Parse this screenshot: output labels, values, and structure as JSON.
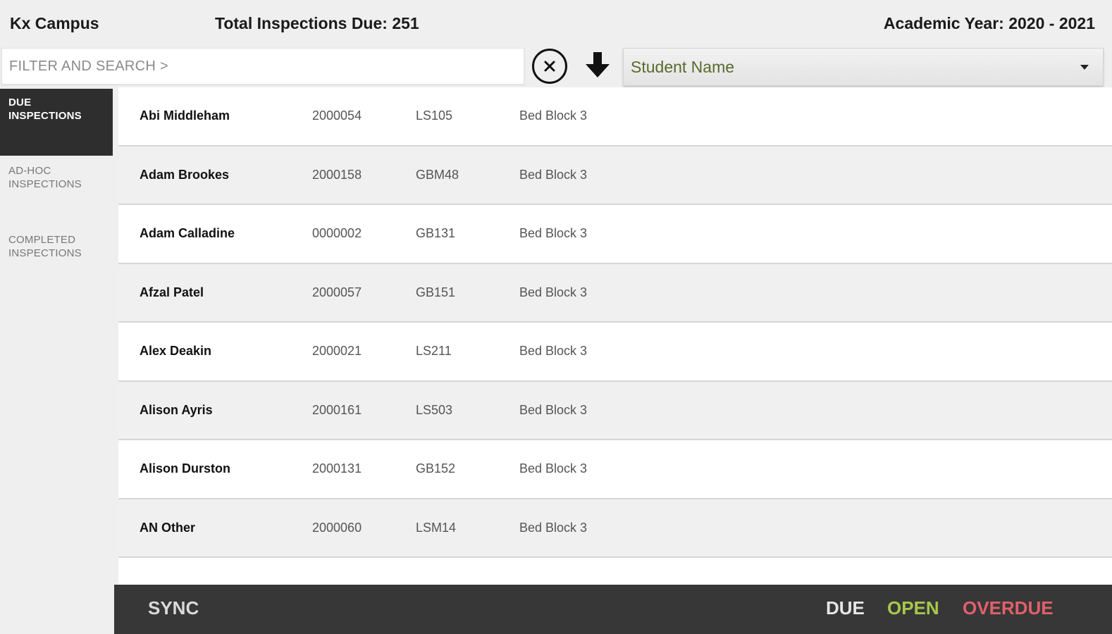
{
  "header": {
    "campus": "Kx Campus",
    "total_due": "Total Inspections Due: 251",
    "academic_year": "Academic Year: 2020 - 2021"
  },
  "toolbar": {
    "search_placeholder": "FILTER AND SEARCH >",
    "sort_selected": "Student Name",
    "clear_icon": "close-circle-icon",
    "download_icon": "arrow-down-icon"
  },
  "sidebar": {
    "items": [
      {
        "label": "DUE INSPECTIONS",
        "active": true
      },
      {
        "label": "AD-HOC INSPECTIONS",
        "active": false
      },
      {
        "label": "COMPLETED INSPECTIONS",
        "active": false
      }
    ]
  },
  "inspections": [
    {
      "name": "Abi Middleham",
      "id": "2000054",
      "room": "LS105",
      "block": "Bed Block 3"
    },
    {
      "name": "Adam Brookes",
      "id": "2000158",
      "room": "GBM48",
      "block": "Bed Block 3"
    },
    {
      "name": "Adam Calladine",
      "id": "0000002",
      "room": "GB131",
      "block": "Bed Block 3"
    },
    {
      "name": "Afzal Patel",
      "id": "2000057",
      "room": "GB151",
      "block": "Bed Block 3"
    },
    {
      "name": "Alex Deakin",
      "id": "2000021",
      "room": "LS211",
      "block": "Bed Block 3"
    },
    {
      "name": "Alison Ayris",
      "id": "2000161",
      "room": "LS503",
      "block": "Bed Block 3"
    },
    {
      "name": "Alison Durston",
      "id": "2000131",
      "room": "GB152",
      "block": "Bed Block 3"
    },
    {
      "name": "AN Other",
      "id": "2000060",
      "room": "LSM14",
      "block": "Bed Block 3"
    }
  ],
  "footer": {
    "sync_label": "SYNC",
    "legend_due": "DUE",
    "legend_open": "OPEN",
    "legend_overdue": "OVERDUE"
  },
  "colors": {
    "sidebar_active_bg": "#2e2e2e",
    "footer_bg": "#373737",
    "open": "#a8c84a",
    "overdue": "#e0606a",
    "sort_text": "#5a6a2d"
  }
}
